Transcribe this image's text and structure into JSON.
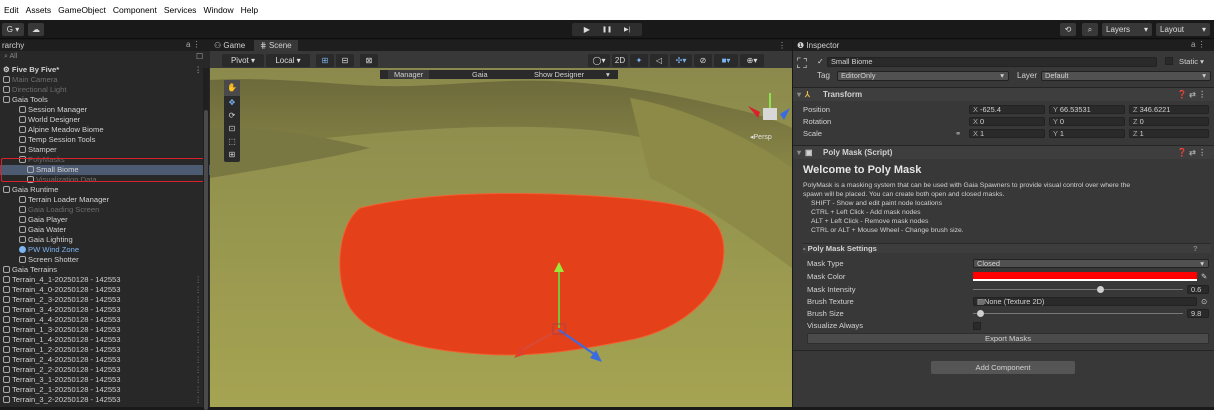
{
  "menubar": [
    "Edit",
    "Assets",
    "GameObject",
    "Component",
    "Services",
    "Window",
    "Help"
  ],
  "toolbar": {
    "account_label": "G ▾",
    "cloud_icon": "cloud-icon",
    "play": "▶",
    "pause": "❚❚",
    "step": "▶|",
    "layers_label": "Layers",
    "layout_label": "Layout"
  },
  "hierarchy": {
    "title": "rarchy",
    "search_placeholder": "All",
    "scene_name": "Five By Five*",
    "items": [
      {
        "label": "Main Camera",
        "indent": 1,
        "dim": true
      },
      {
        "label": "Directional Light",
        "indent": 1,
        "dim": true
      },
      {
        "label": "Gaia Tools",
        "indent": 1
      },
      {
        "label": "Session Manager",
        "indent": 2
      },
      {
        "label": "World Designer",
        "indent": 2
      },
      {
        "label": "Alpine Meadow Biome",
        "indent": 2
      },
      {
        "label": "Temp Session Tools",
        "indent": 2
      },
      {
        "label": "Stamper",
        "indent": 2
      },
      {
        "label": "PolyMasks",
        "indent": 2,
        "dim": true
      },
      {
        "label": "Small Biome",
        "indent": 3,
        "selected": true
      },
      {
        "label": "Visualization Data",
        "indent": 3,
        "dim": true
      },
      {
        "label": "Gaia Runtime",
        "indent": 1
      },
      {
        "label": "Terrain Loader Manager",
        "indent": 2
      },
      {
        "label": "Gaia Loading Screen",
        "indent": 2,
        "dim": true
      },
      {
        "label": "Gaia Player",
        "indent": 2
      },
      {
        "label": "Gaia Water",
        "indent": 2
      },
      {
        "label": "Gaia Lighting",
        "indent": 2
      },
      {
        "label": "PW Wind Zone",
        "indent": 2,
        "blue": true
      },
      {
        "label": "Screen Shotter",
        "indent": 2
      },
      {
        "label": "Gaia Terrains",
        "indent": 1
      },
      {
        "label": "Terrain_4_1-20250128 - 142553",
        "indent": 1
      },
      {
        "label": "Terrain_4_0-20250128 - 142553",
        "indent": 1
      },
      {
        "label": "Terrain_2_3-20250128 - 142553",
        "indent": 1
      },
      {
        "label": "Terrain_3_4-20250128 - 142553",
        "indent": 1
      },
      {
        "label": "Terrain_4_4-20250128 - 142553",
        "indent": 1
      },
      {
        "label": "Terrain_1_3-20250128 - 142553",
        "indent": 1
      },
      {
        "label": "Terrain_1_4-20250128 - 142553",
        "indent": 1
      },
      {
        "label": "Terrain_1_2-20250128 - 142553",
        "indent": 1
      },
      {
        "label": "Terrain_2_4-20250128 - 142553",
        "indent": 1
      },
      {
        "label": "Terrain_2_2-20250128 - 142553",
        "indent": 1
      },
      {
        "label": "Terrain_3_1-20250128 - 142553",
        "indent": 1
      },
      {
        "label": "Terrain_2_1-20250128 - 142553",
        "indent": 1
      },
      {
        "label": "Terrain_3_2-20250128 - 142553",
        "indent": 1
      }
    ]
  },
  "scene": {
    "tab_game": "Game",
    "tab_scene": "Scene",
    "pivot": "Pivot",
    "local": "Local",
    "overlay_manager": "Manager",
    "overlay_gaia": "Gaia",
    "overlay_show": "Show Designer",
    "persp": "Persp",
    "twod": "2D",
    "colors": {
      "mask": "#e4401a",
      "terrain": "#9a9a46"
    }
  },
  "inspector": {
    "title": "Inspector",
    "object_name": "Small Biome",
    "static_label": "Static",
    "tag_label": "Tag",
    "tag_value": "EditorOnly",
    "layer_label": "Layer",
    "layer_value": "Default",
    "transform": {
      "title": "Transform",
      "position": {
        "label": "Position",
        "x": "-625.4",
        "y": "66.53531",
        "z": "346.6221"
      },
      "rotation": {
        "label": "Rotation",
        "x": "0",
        "y": "0",
        "z": "0"
      },
      "scale": {
        "label": "Scale",
        "x": "1",
        "y": "1",
        "z": "1"
      }
    },
    "polymask": {
      "title": "Poly Mask (Script)",
      "welcome": "Welcome to Poly Mask",
      "desc1": "PolyMask is a masking system that can be used with Gaia Spawners to provide visual control over where the",
      "desc2": "spawn will be placed. You can create both open and closed masks.",
      "help": [
        "SHIFT - Show and edit paint node locations",
        "CTRL  + Left Click - Add mask nodes",
        "ALT    + Left Click - Remove mask nodes",
        "CTRL or ALT + Mouse Wheel - Change brush size."
      ],
      "settings_title": "- Poly Mask Settings",
      "mask_type_label": "Mask Type",
      "mask_type_value": "Closed",
      "mask_color_label": "Mask Color",
      "mask_color": "#ff0000",
      "mask_intensity_label": "Mask Intensity",
      "mask_intensity": "0.6",
      "brush_texture_label": "Brush Texture",
      "brush_texture_value": "None (Texture 2D)",
      "brush_size_label": "Brush Size",
      "brush_size": "9.8",
      "visualize_label": "Visualize Always",
      "export_label": "Export Masks"
    },
    "add_component": "Add Component"
  }
}
